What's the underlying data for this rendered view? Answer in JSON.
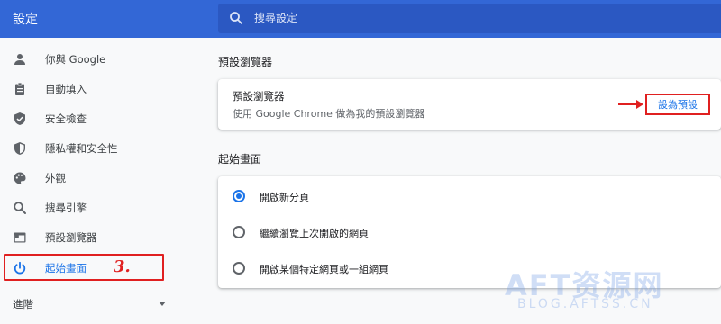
{
  "app": {
    "title": "設定"
  },
  "search": {
    "placeholder": "搜尋設定"
  },
  "sidebar": {
    "items": [
      {
        "label": "你與 Google",
        "icon": "person-icon"
      },
      {
        "label": "自動填入",
        "icon": "clipboard-icon"
      },
      {
        "label": "安全檢查",
        "icon": "shield-check-icon"
      },
      {
        "label": "隱私權和安全性",
        "icon": "shield-icon"
      },
      {
        "label": "外觀",
        "icon": "palette-icon"
      },
      {
        "label": "搜尋引擎",
        "icon": "search-icon"
      },
      {
        "label": "預設瀏覽器",
        "icon": "browser-icon"
      },
      {
        "label": "起始畫面",
        "icon": "power-icon",
        "active": true
      }
    ],
    "advanced_label": "進階"
  },
  "annotation": {
    "step": "3."
  },
  "default_browser": {
    "section_title": "預設瀏覽器",
    "title": "預設瀏覽器",
    "description": "使用 Google Chrome 做為我的預設瀏覽器",
    "button_label": "設為預設"
  },
  "startup": {
    "section_title": "起始畫面",
    "options": [
      {
        "label": "開啟新分頁",
        "checked": true
      },
      {
        "label": "繼續瀏覽上次開啟的網頁",
        "checked": false
      },
      {
        "label": "開啟某個特定網頁或一組網頁",
        "checked": false
      }
    ]
  },
  "watermark": {
    "main": "AFT资源网",
    "sub": "BLOG.AFTSS.CN"
  },
  "colors": {
    "header": "#3367d6",
    "accent": "#1a73e8",
    "annotation": "#e02020"
  }
}
